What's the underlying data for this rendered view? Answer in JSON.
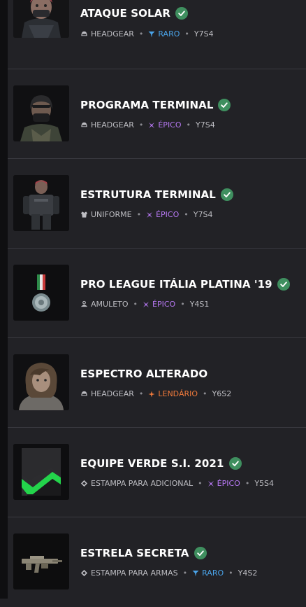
{
  "items": [
    {
      "title": "ATAQUE SOLAR",
      "type": "HEADGEAR",
      "type_icon": "helmet-icon",
      "rarity": "RARO",
      "rarity_class": "r-raro",
      "rarity_icon": "raro-icon",
      "season": "Y7S4",
      "owned": true,
      "thumb": "operator-headgear-red"
    },
    {
      "title": "PROGRAMA TERMINAL",
      "type": "HEADGEAR",
      "type_icon": "helmet-icon",
      "rarity": "ÉPICO",
      "rarity_class": "r-epico",
      "rarity_icon": "epico-icon",
      "season": "Y7S4",
      "owned": true,
      "thumb": "operator-headgear-dark"
    },
    {
      "title": "ESTRUTURA TERMINAL",
      "type": "UNIFORME",
      "type_icon": "uniform-icon",
      "rarity": "ÉPICO",
      "rarity_class": "r-epico",
      "rarity_icon": "epico-icon",
      "season": "Y7S4",
      "owned": true,
      "thumb": "operator-uniform"
    },
    {
      "title": "PRO LEAGUE ITÁLIA PLATINA '19",
      "type": "AMULETO",
      "type_icon": "charm-icon",
      "rarity": "ÉPICO",
      "rarity_class": "r-epico",
      "rarity_icon": "epico-icon",
      "season": "Y4S1",
      "owned": true,
      "thumb": "medal-charm"
    },
    {
      "title": "ESPECTRO ALTERADO",
      "type": "HEADGEAR",
      "type_icon": "helmet-icon",
      "rarity": "LENDÁRIO",
      "rarity_class": "r-lend",
      "rarity_icon": "lendario-icon",
      "season": "Y6S2",
      "owned": false,
      "thumb": "operator-headgear-hair"
    },
    {
      "title": "EQUIPE VERDE S.I. 2021",
      "type": "ESTAMPA PARA ADICIONAL",
      "type_icon": "skin-icon",
      "rarity": "ÉPICO",
      "rarity_class": "r-epico",
      "rarity_icon": "epico-icon",
      "season": "Y5S4",
      "owned": true,
      "thumb": "green-team-skin"
    },
    {
      "title": "ESTRELA SECRETA",
      "type": "ESTAMPA PARA ARMAS",
      "type_icon": "skin-icon",
      "rarity": "RARO",
      "rarity_class": "r-raro",
      "rarity_icon": "raro-icon",
      "season": "Y4S2",
      "owned": true,
      "thumb": "rifle-skin"
    }
  ],
  "colors": {
    "background": "#222226",
    "divider": "#3a3a40",
    "owned_check": "#3f8f5f",
    "raro": "#4aa3e8",
    "epico": "#b678f2",
    "lendario": "#f07a3b"
  }
}
